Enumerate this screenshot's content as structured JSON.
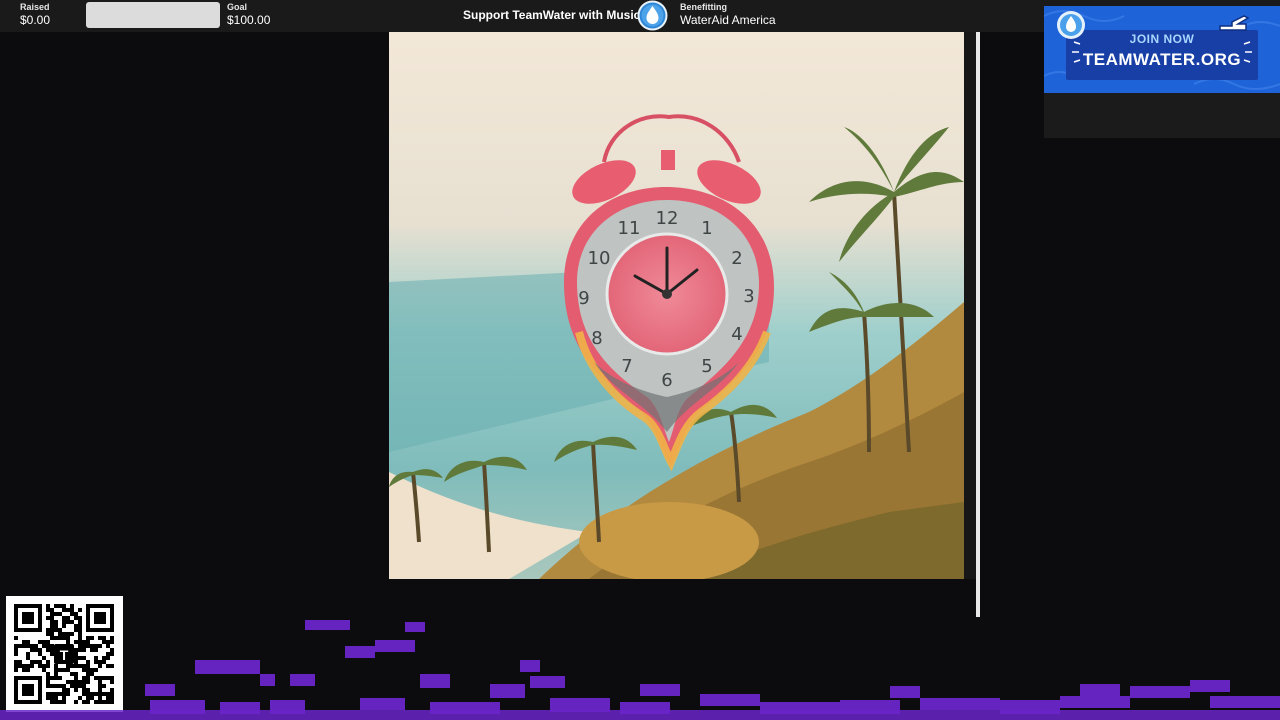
{
  "donation": {
    "raised_label": "Raised",
    "raised_value": "$0.00",
    "goal_label": "Goal",
    "goal_value": "$100.00",
    "progress_fraction": 0,
    "campaign_title": "Support TeamWater with Music",
    "benefit_label": "Benefitting",
    "benefit_value": "WaterAid America"
  },
  "banner": {
    "kicker": "JOIN NOW",
    "main": "TEAMWATER.ORG"
  },
  "colors": {
    "background": "#0c0b0d",
    "topbar": "#1a1a1b",
    "banner_blue": "#1f63d9",
    "visualizer_purple": "#6a25c9"
  },
  "icons": {
    "drop": "water-drop-icon",
    "hand": "pointing-hand-icon",
    "qr": "qr-code"
  }
}
